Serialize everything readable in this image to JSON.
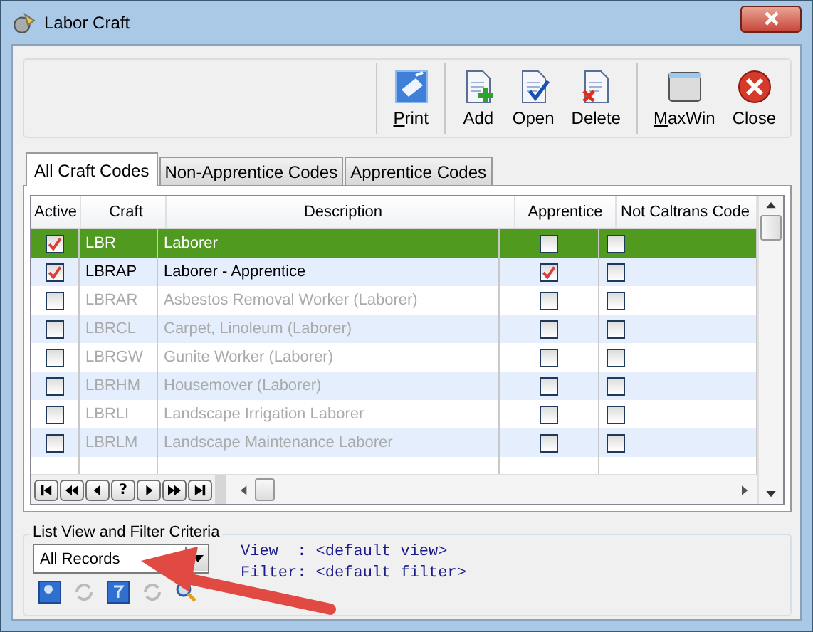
{
  "window": {
    "title": "Labor Craft"
  },
  "toolbar": [
    {
      "buttons": [
        {
          "label": "Print",
          "kind": "print",
          "mnemonic": true
        }
      ]
    },
    {
      "buttons": [
        {
          "label": "Add",
          "kind": "add",
          "mnemonic": false
        },
        {
          "label": "Open",
          "kind": "open",
          "mnemonic": false
        },
        {
          "label": "Delete",
          "kind": "delete",
          "mnemonic": false
        }
      ]
    },
    {
      "buttons": [
        {
          "label": "MaxWin",
          "kind": "maxwin",
          "mnemonic": true
        },
        {
          "label": "Close",
          "kind": "close",
          "mnemonic": false
        }
      ]
    }
  ],
  "tabs": [
    {
      "label": "All Craft Codes",
      "selected": true
    },
    {
      "label": "Non-Apprentice Codes",
      "selected": false
    },
    {
      "label": "Apprentice Codes",
      "selected": false
    }
  ],
  "table": {
    "columns": [
      "Active",
      "Craft",
      "Description",
      "Apprentice",
      "Not Caltrans Code"
    ],
    "rows": [
      {
        "active": true,
        "craft": "LBR",
        "description": "Laborer",
        "apprentice": false,
        "not_caltrans": false,
        "selected": true
      },
      {
        "active": true,
        "craft": "LBRAP",
        "description": "Laborer - Apprentice",
        "apprentice": true,
        "not_caltrans": false,
        "selected": false
      },
      {
        "active": false,
        "craft": "LBRAR",
        "description": "Asbestos Removal Worker (Laborer)",
        "apprentice": false,
        "not_caltrans": false,
        "selected": false
      },
      {
        "active": false,
        "craft": "LBRCL",
        "description": "Carpet, Linoleum (Laborer)",
        "apprentice": false,
        "not_caltrans": false,
        "selected": false
      },
      {
        "active": false,
        "craft": "LBRGW",
        "description": "Gunite Worker (Laborer)",
        "apprentice": false,
        "not_caltrans": false,
        "selected": false
      },
      {
        "active": false,
        "craft": "LBRHM",
        "description": "Housemover (Laborer)",
        "apprentice": false,
        "not_caltrans": false,
        "selected": false
      },
      {
        "active": false,
        "craft": "LBRLI",
        "description": "Landscape Irrigation Laborer",
        "apprentice": false,
        "not_caltrans": false,
        "selected": false
      },
      {
        "active": false,
        "craft": "LBRLM",
        "description": "Landscape Maintenance Laborer",
        "apprentice": false,
        "not_caltrans": false,
        "selected": false
      }
    ]
  },
  "navigator": {
    "help_label": "?"
  },
  "filter": {
    "legend": "List View and Filter Criteria",
    "dropdown_value": "All Records",
    "view_line": "View  : <default view>",
    "filter_line": "Filter: <default filter>"
  }
}
